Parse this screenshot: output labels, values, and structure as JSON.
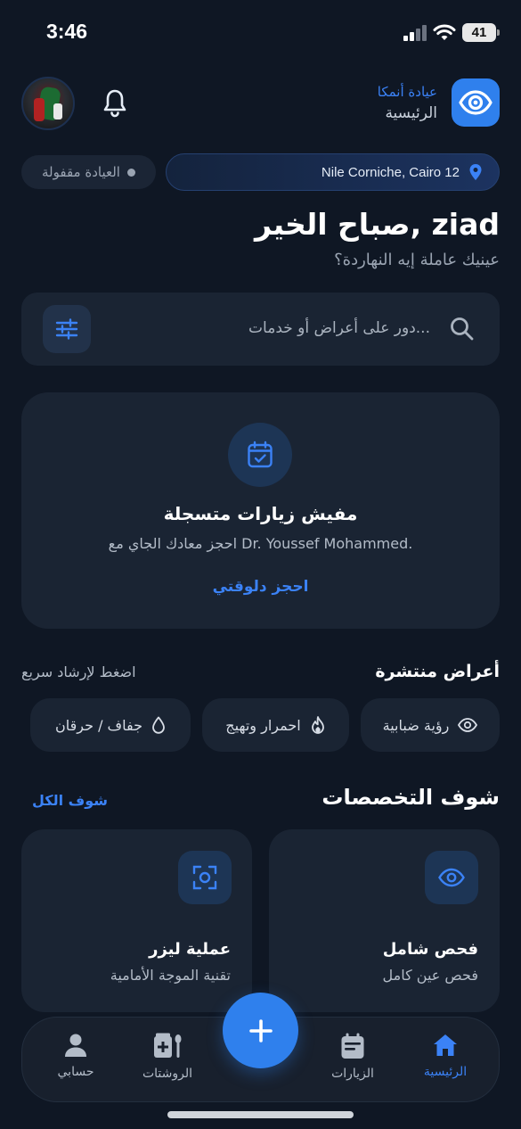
{
  "status_bar": {
    "time": "3:46",
    "battery": "41"
  },
  "header": {
    "clinic_name": "عيادة أنمكا",
    "page_label": "الرئيسية"
  },
  "location": {
    "closed_label": "العيادة مقفولة",
    "address": "Nile Corniche, Cairo 12"
  },
  "greeting": {
    "title": "صباح الخير, ziad",
    "subtitle": "عينيك عاملة إيه النهاردة؟"
  },
  "search": {
    "placeholder": "دور على أعراض أو خدمات..."
  },
  "empty_state": {
    "title": "مفيش زيارات متسجلة",
    "subtitle": "احجز معادك الجاي مع Dr. Youssef Mohammed.",
    "link": "احجز دلوقتي"
  },
  "symptoms": {
    "title": "أعراض منتشرة",
    "hint": "اضغط لإرشاد سريع",
    "items": [
      {
        "label": "رؤية ضبابية",
        "icon": "eye-icon"
      },
      {
        "label": "احمرار وتهيج",
        "icon": "flame-icon"
      },
      {
        "label": "جفاف / حرقان",
        "icon": "droplet-icon"
      }
    ]
  },
  "specialties": {
    "title": "شوف التخصصات",
    "see_all": "شوف الكل",
    "items": [
      {
        "name": "فحص شامل",
        "desc": "فحص عين كامل",
        "icon": "eye-icon"
      },
      {
        "name": "عملية ليزر",
        "desc": "تقنية الموجة الأمامية",
        "icon": "focus-icon"
      }
    ]
  },
  "nav": {
    "items": [
      {
        "label": "الرئيسية",
        "icon": "home-icon",
        "active": true
      },
      {
        "label": "الزيارات",
        "icon": "calendar-list-icon"
      },
      {
        "label": "الروشتات",
        "icon": "prescription-icon"
      },
      {
        "label": "حسابي",
        "icon": "user-icon"
      }
    ]
  },
  "colors": {
    "background": "#0f1724",
    "card": "#1a2433",
    "accent": "#2f80ed",
    "link": "#3b82f6"
  }
}
